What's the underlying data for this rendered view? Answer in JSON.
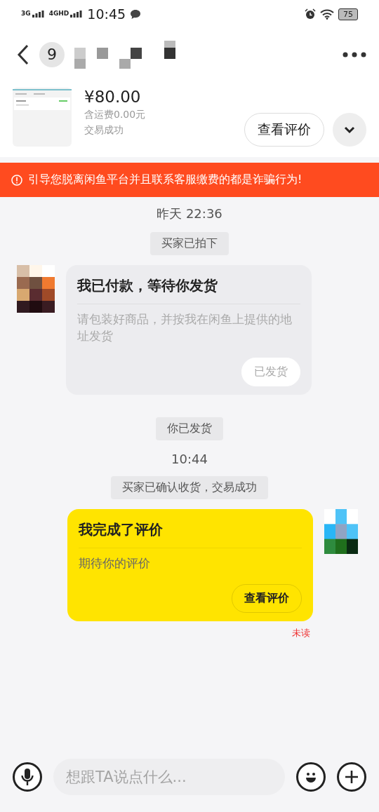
{
  "status_bar": {
    "network_1": "3G",
    "network_2": "4GHD",
    "time": "10:45",
    "battery": "75"
  },
  "header": {
    "back_count": "9"
  },
  "product": {
    "price": "¥80.00",
    "shipping": "含运费0.00元",
    "status": "交易成功",
    "action": "查看评价"
  },
  "warning": "引导您脱离闲鱼平台并且联系客服缴费的都是诈骗行为!",
  "messages": [
    {
      "kind": "time",
      "text": "昨天 22:36"
    },
    {
      "kind": "system",
      "text": "买家已拍下"
    },
    {
      "kind": "card",
      "outgoing": false,
      "title": "我已付款，等待你发货",
      "body": "请包装好商品，并按我在闲鱼上提供的地址发货",
      "button": {
        "label": "已发货",
        "disabled": true
      }
    },
    {
      "kind": "system",
      "text": "你已发货"
    },
    {
      "kind": "time",
      "text": "10:44"
    },
    {
      "kind": "system",
      "text": "买家已确认收货，交易成功"
    },
    {
      "kind": "card",
      "outgoing": true,
      "title": "我完成了评价",
      "body": "期待你的评价",
      "button": {
        "label": "查看评价",
        "disabled": false
      },
      "receipt": "未读"
    }
  ],
  "input": {
    "placeholder": "想跟TA说点什么..."
  }
}
